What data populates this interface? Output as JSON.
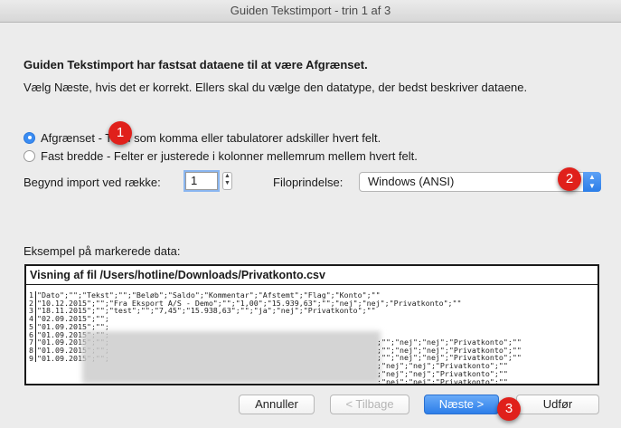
{
  "window": {
    "title": "Guiden Tekstimport - trin 1 af 3"
  },
  "intro": {
    "heading": "Guiden Tekstimport har fastsat dataene til at være Afgrænset.",
    "description": "Vælg Næste, hvis det er korrekt. Ellers skal du vælge den datatype, der bedst beskriver dataene."
  },
  "options": {
    "delimited_label": "Afgrænset - Tegn som komma eller tabulatorer adskiller hvert felt.",
    "fixed_width_label": "Fast bredde - Felter er justerede i kolonner mellemrum mellem hvert felt.",
    "selected": "delimited"
  },
  "start_row": {
    "label": "Begynd import ved række:",
    "value": "1"
  },
  "file_origin": {
    "label": "Filoprindelse:",
    "value": "Windows (ANSI)"
  },
  "preview": {
    "label": "Eksempel på markerede data:",
    "title": "Visning af fil /Users/hotline/Downloads/Privatkonto.csv",
    "lines": [
      {
        "n": "1",
        "text": "\"Dato\";\"\";\"Tekst\";\"\";\"Beløb\";\"Saldo\";\"Kommentar\";\"Afstemt\";\"Flag\";\"Konto\";\"\""
      },
      {
        "n": "2",
        "text": "\"10.12.2015\";\"\";\"Fra Eksport A/S - Demo\";\"\";\"1,00\";\"15.939,63\";\"\";\"nej\";\"nej\";\"Privatkonto\";\"\""
      },
      {
        "n": "3",
        "text": "\"18.11.2015\";\"\";\"test\";\"\";\"7,45\";\"15.938,63\";\"\";\"ja\";\"nej\";\"Privatkonto\";\"\""
      },
      {
        "n": "4",
        "text": "\"02.09.2015\";\"\";"
      },
      {
        "n": "5",
        "text": "\"01.09.2015\";\"\";"
      },
      {
        "n": "6",
        "text": "\"01.09.2015\";\"\";"
      },
      {
        "n": "7",
        "text": "\"01.09.2015\";\"\";"
      },
      {
        "n": "8",
        "text": "\"01.09.2015\";\"\";"
      },
      {
        "n": "9",
        "text": "\"01.09.2015\";\"\";"
      }
    ],
    "tails": [
      ";\"\";\"nej\";\"nej\";\"Privatkonto\";\"\"",
      ";\"\";\"nej\";\"nej\";\"Privatkonto\";\"\"",
      ";\"\";\"nej\";\"nej\";\"Privatkonto\";\"\"",
      ";\"nej\";\"nej\";\"Privatkonto\";\"\"",
      ";\"nej\";\"nej\";\"Privatkonto\";\"\"",
      ";\"nej\";\"nej\";\"Privatkonto\";\"\""
    ]
  },
  "buttons": {
    "cancel": "Annuller",
    "back": "< Tilbage",
    "next": "Næste >",
    "finish": "Udfør"
  },
  "markers": [
    "1",
    "2",
    "3"
  ],
  "colors": {
    "accent": "#3a8cf2",
    "marker": "#e0201b"
  }
}
